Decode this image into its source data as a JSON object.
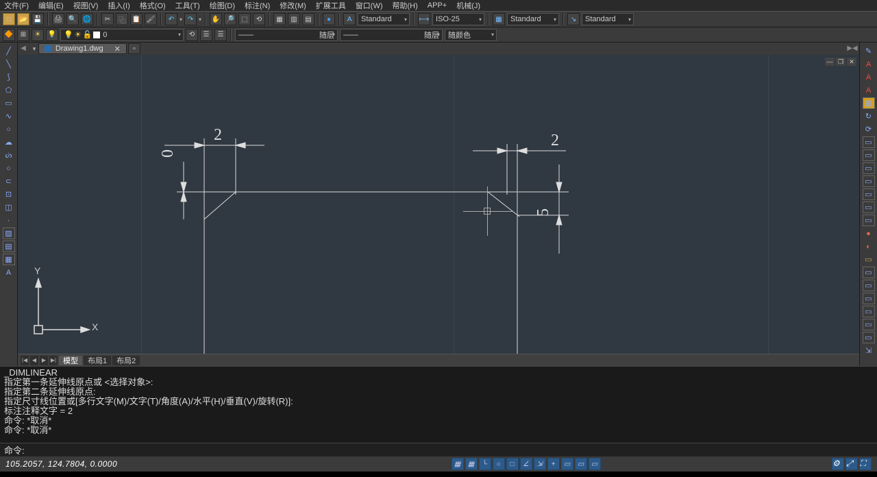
{
  "menu": [
    "文件(F)",
    "编辑(E)",
    "视图(V)",
    "插入(I)",
    "格式(O)",
    "工具(T)",
    "绘图(D)",
    "标注(N)",
    "修改(M)",
    "扩展工具",
    "窗口(W)",
    "帮助(H)",
    "APP+",
    "机械(J)"
  ],
  "toolbar1": {
    "text_style": "Standard",
    "dim_style": "ISO-25",
    "table_style": "Standard",
    "mleader_style": "Standard"
  },
  "layerbar": {
    "layer_label": "0",
    "linetype": "随层",
    "lineweight": "随层",
    "color": "随颜色"
  },
  "doc_tab": {
    "name": "Drawing1.dwg"
  },
  "model_tabs": [
    "模型",
    "布局1",
    "布局2"
  ],
  "drawing": {
    "dim_left": "2",
    "dim_left_vert": "0",
    "dim_right": "2",
    "dim_right_vert": "5"
  },
  "ucs": {
    "x": "X",
    "y": "Y"
  },
  "command_history": [
    "_DIMLINEAR",
    "指定第一条延伸线原点或 <选择对象>:",
    "指定第二条延伸线原点:",
    "指定尺寸线位置或[多行文字(M)/文字(T)/角度(A)/水平(H)/垂直(V)/旋转(R)]:",
    "标注注释文字 = 2",
    "命令: *取消*",
    "命令: *取消*"
  ],
  "command_prompt": "命令:",
  "status": {
    "coords": "105.2057, 124.7804, 0.0000"
  }
}
